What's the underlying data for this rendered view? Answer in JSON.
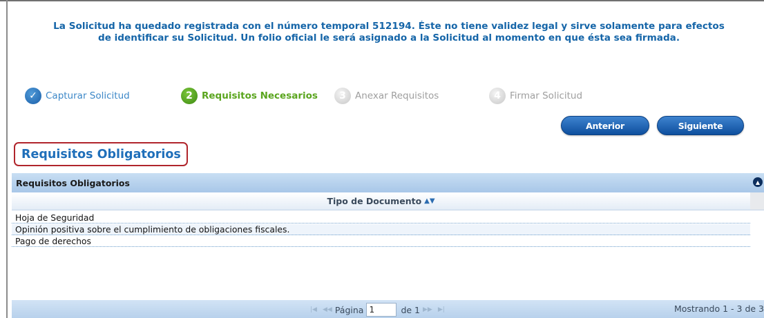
{
  "notice": {
    "line1": "La Solicitud ha quedado registrada con el número temporal 512194. Éste no tiene validez legal y sirve solamente para efectos",
    "line2": "de identificar su Solicitud. Un folio oficial le será asignado a la Solicitud al momento en que ésta sea firmada."
  },
  "steps": [
    {
      "number": "✓",
      "label": "Capturar Solicitud",
      "state": "done"
    },
    {
      "number": "2",
      "label": "Requisitos Necesarios",
      "state": "active"
    },
    {
      "number": "3",
      "label": "Anexar Requisitos",
      "state": "pending"
    },
    {
      "number": "4",
      "label": "Firmar Solicitud",
      "state": "pending"
    }
  ],
  "buttons": {
    "previous": "Anterior",
    "next": "Siguiente"
  },
  "section_title": "Requisitos Obligatorios",
  "grid": {
    "caption": "Requisitos Obligatorios",
    "column_header": "Tipo de Documento",
    "rows": [
      "Hoja de Seguridad",
      "Opinión positiva sobre el cumplimiento de obligaciones fiscales.",
      "Pago de derechos"
    ],
    "pager": {
      "page_label": "Página",
      "page_value": "1",
      "of_label": "de 1"
    },
    "showing": "Mostrando 1 - 3 de 3"
  },
  "colors": {
    "accent": "#1565a8",
    "active_step": "#5aa51e",
    "highlight_border": "#b0242b"
  }
}
